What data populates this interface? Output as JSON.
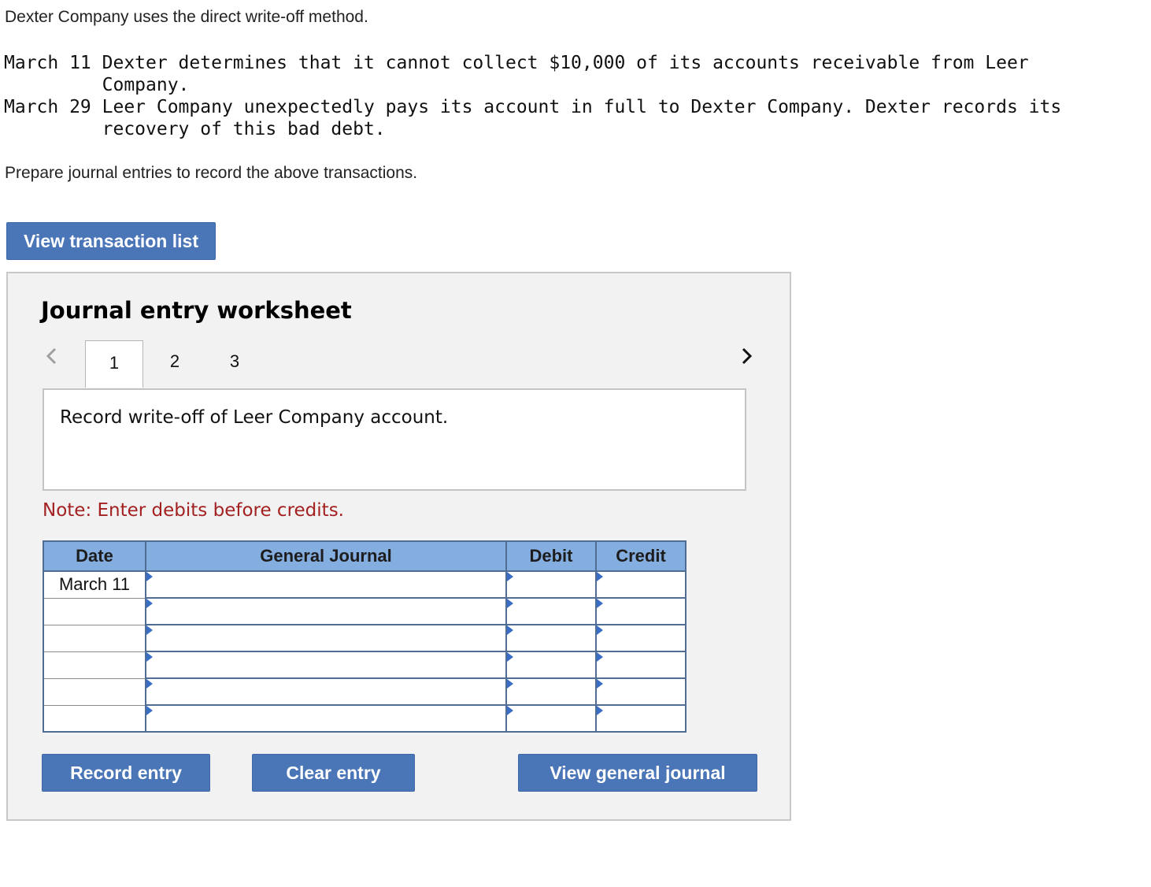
{
  "intro": "Dexter Company uses the direct write-off method.",
  "transactions": [
    {
      "line1": "March 11 Dexter determines that it cannot collect $10,000 of its accounts receivable from Leer",
      "line2": "         Company."
    },
    {
      "line1": "March 29 Leer Company unexpectedly pays its account in full to Dexter Company. Dexter records its",
      "line2": "         recovery of this bad debt."
    }
  ],
  "prepare": "Prepare journal entries to record the above transactions.",
  "view_transaction_list": "View transaction list",
  "worksheet": {
    "title": "Journal entry worksheet",
    "prev_icon": "‹",
    "next_icon": "›",
    "tabs": [
      "1",
      "2",
      "3"
    ],
    "description": "Record write-off of Leer Company account.",
    "note": "Note: Enter debits before credits.",
    "columns": {
      "date": "Date",
      "general_journal": "General Journal",
      "debit": "Debit",
      "credit": "Credit"
    },
    "rows": [
      {
        "date": "March 11"
      },
      {
        "date": ""
      },
      {
        "date": ""
      },
      {
        "date": ""
      },
      {
        "date": ""
      },
      {
        "date": ""
      }
    ],
    "buttons": {
      "record": "Record entry",
      "clear": "Clear entry",
      "view_journal": "View general journal"
    }
  }
}
